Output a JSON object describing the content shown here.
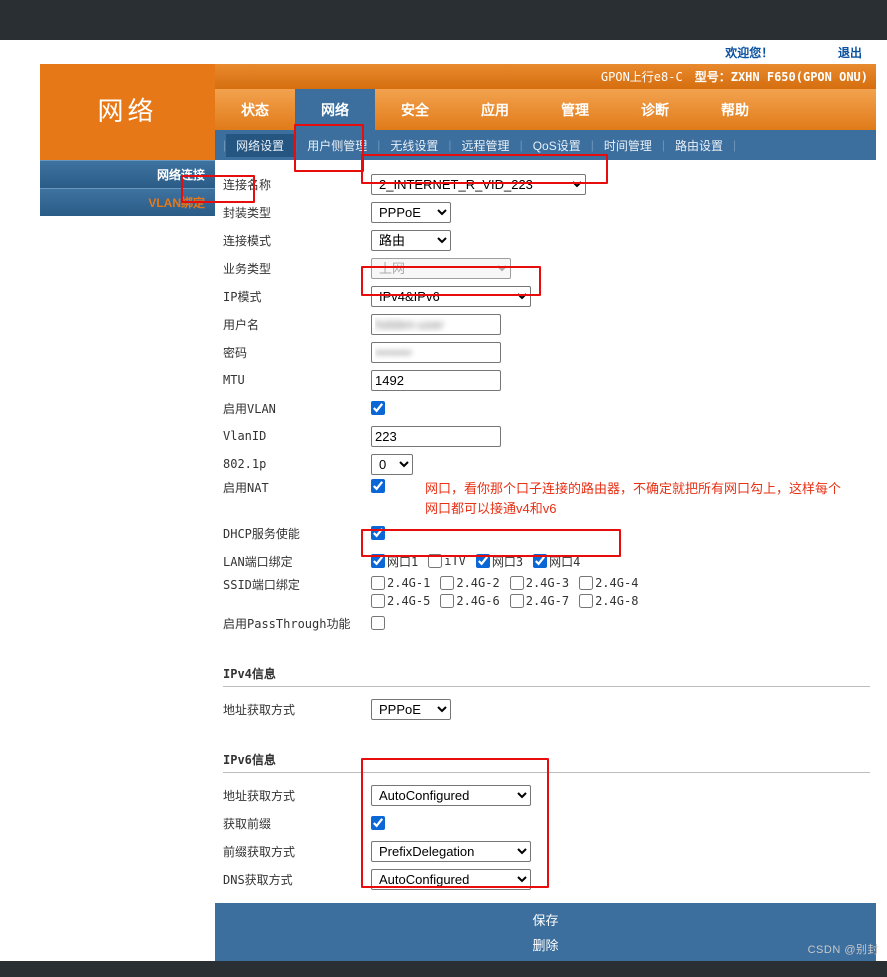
{
  "welcome": {
    "hello": "欢迎您！",
    "logout": "退出"
  },
  "header": {
    "uplink": "GPON上行e8-C",
    "model_label": "型号：",
    "model": "ZXHN F650(GPON ONU)"
  },
  "brand": "网络",
  "tabs": [
    "状态",
    "网络",
    "安全",
    "应用",
    "管理",
    "诊断",
    "帮助"
  ],
  "subnav": [
    "网络设置",
    "用户侧管理",
    "无线设置",
    "远程管理",
    "QoS设置",
    "时间管理",
    "路由设置"
  ],
  "side": [
    "网络连接",
    "VLAN绑定"
  ],
  "labels": {
    "conn_name": "连接名称",
    "encap": "封装类型",
    "conn_mode": "连接模式",
    "biz_type": "业务类型",
    "ip_mode": "IP模式",
    "user": "用户名",
    "pass": "密码",
    "mtu": "MTU",
    "vlan_en": "启用VLAN",
    "vlan_id": "VlanID",
    "p8021": "802.1p",
    "nat_en": "启用NAT",
    "dhcp_en": "DHCP服务使能",
    "lan_bind": "LAN端口绑定",
    "ssid_bind": "SSID端口绑定",
    "pt_en": "启用PassThrough功能",
    "ipv4_sec": "IPv4信息",
    "ipv4_mode": "地址获取方式",
    "ipv6_sec": "IPv6信息",
    "ipv6_mode": "地址获取方式",
    "prefix_get": "获取前缀",
    "prefix_mode": "前缀获取方式",
    "dns_mode": "DNS获取方式"
  },
  "lan_ports": [
    {
      "label": "网口1",
      "checked": true
    },
    {
      "label": "iTV",
      "checked": false
    },
    {
      "label": "网口3",
      "checked": true
    },
    {
      "label": "网口4",
      "checked": true
    }
  ],
  "ssid_ports_a": [
    "2.4G-1",
    "2.4G-2",
    "2.4G-3",
    "2.4G-4"
  ],
  "ssid_ports_b": [
    "2.4G-5",
    "2.4G-6",
    "2.4G-7",
    "2.4G-8"
  ],
  "values": {
    "conn_name": "2_INTERNET_R_VID_223",
    "encap": "PPPoE",
    "conn_mode": "路由",
    "biz_type": "上网",
    "ip_mode": "IPv4&IPv6",
    "user": "hidden-user",
    "pass": "hidden-pass",
    "mtu": "1492",
    "vlan_id": "223",
    "p8021": "0",
    "ipv4_mode": "PPPoE",
    "ipv6_mode": "AutoConfigured",
    "prefix_mode": "PrefixDelegation",
    "dns_mode": "AutoConfigured"
  },
  "note": "网口，看你那个口子连接的路由器，不确定就把所有网口勾上，这样每个网口都可以接通v4和v6",
  "footer": {
    "save": "保存",
    "delete": "删除"
  },
  "watermark": "CSDN @别封"
}
